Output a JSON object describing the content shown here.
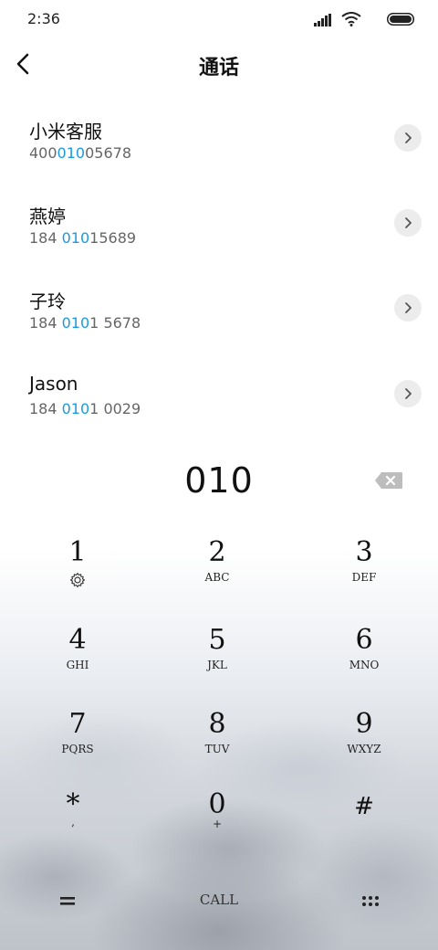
{
  "status_bar": {
    "time": "2:36",
    "icons": [
      "signal-icon",
      "wifi-icon",
      "battery-icon"
    ]
  },
  "header": {
    "title": "通话",
    "back_icon": "chevron-left-icon"
  },
  "contacts": [
    {
      "name": "小米客服",
      "number_pre": "400",
      "number_hl": "010",
      "number_post": "05678"
    },
    {
      "name": "燕婷",
      "number_pre": "184 ",
      "number_hl": "010",
      "number_post": "15689"
    },
    {
      "name": "子玲",
      "number_pre": "184 ",
      "number_hl": "010",
      "number_post": "1 5678"
    },
    {
      "name": "Jason",
      "number_pre": "184 ",
      "number_hl": "010",
      "number_post": "1 0029"
    }
  ],
  "dialer": {
    "entered": "010",
    "backspace_icon": "backspace-icon",
    "keys": [
      {
        "digit": "1",
        "letters": "",
        "icon": "voicemail-gear-icon"
      },
      {
        "digit": "2",
        "letters": "ABC"
      },
      {
        "digit": "3",
        "letters": "DEF"
      },
      {
        "digit": "4",
        "letters": "GHI"
      },
      {
        "digit": "5",
        "letters": "JKL"
      },
      {
        "digit": "6",
        "letters": "MNO"
      },
      {
        "digit": "7",
        "letters": "PQRS"
      },
      {
        "digit": "8",
        "letters": "TUV"
      },
      {
        "digit": "9",
        "letters": "WXYZ"
      },
      {
        "digit": "*",
        "letters": ","
      },
      {
        "digit": "0",
        "letters": "+"
      },
      {
        "digit": "#",
        "letters": ""
      }
    ]
  },
  "bottom_bar": {
    "menu_icon": "menu-equals-icon",
    "call_label": "CALL",
    "grid_icon": "dots-grid-icon"
  },
  "colors": {
    "highlight": "#1a9ae0",
    "text_primary": "#111111",
    "text_secondary": "#666666"
  }
}
